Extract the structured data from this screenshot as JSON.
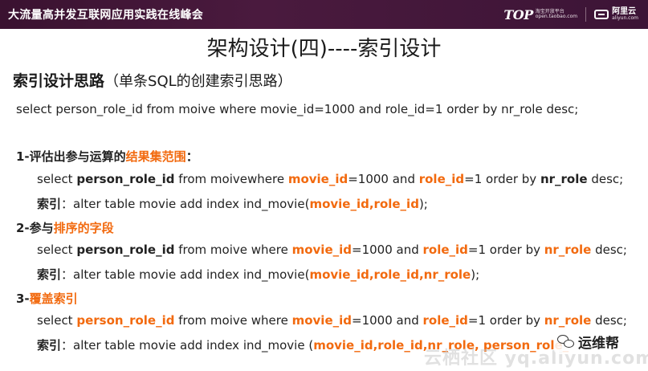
{
  "header": {
    "title": "大流量高并发互联网应用实践在线峰会",
    "brand_top": "TOP",
    "brand_sub_1": "淘宝开放平台",
    "brand_sub_2": "open.taobao.com",
    "brand_aliyun_cn": "阿里云",
    "brand_aliyun_en": "aliyun.com"
  },
  "slide": {
    "title": "架构设计(四)----索引设计",
    "subtitle_bold": "索引设计思路",
    "subtitle_normal": "（单条SQL的创建索引思路）",
    "query": "select  person_role_id from moive  where movie_id=1000 and role_id=1 order by nr_role desc;",
    "section1": {
      "num": "1-评估出参与运算的",
      "highlight": "结果集范围",
      "colon": "：",
      "q_1": "select  ",
      "q_2": "person_role_id",
      "q_3": " from moivewhere ",
      "q_4": "movie_id",
      "q_5": "=1000 and ",
      "q_6": "role_id",
      "q_7": "=1 order by ",
      "q_8": "nr_role",
      "q_9": " desc;",
      "idx_label": "索引",
      "idx_text": "：alter table movie add index ind_movie(",
      "idx_cols": "movie_id,role_id",
      "idx_end": ");"
    },
    "section2": {
      "num": "2-参与",
      "highlight": "排序的字段",
      "q_1": "select  ",
      "q_2": "person_role_id",
      "q_3": " from moive where ",
      "q_4": "movie_id",
      "q_5": "=1000  and ",
      "q_6": "role_id",
      "q_7": "=1 order by ",
      "q_8": "nr_role",
      "q_9": " desc;",
      "idx_label": "索引",
      "idx_text": "：alter table movie add index ind_movie(",
      "idx_cols": "movie_id,role_id,nr_role",
      "idx_end": ");"
    },
    "section3": {
      "num": "3-",
      "highlight": "覆盖索引",
      "q_1": "select  ",
      "q_2": "person_role_id",
      "q_3": " from moive where ",
      "q_4": "movie_id",
      "q_5": "=1000  and ",
      "q_6": "role_id",
      "q_7": "=1 order by ",
      "q_8": "nr_role",
      "q_9": " desc;",
      "idx_label": "索引",
      "idx_text": "：alter table movie add index ind_movie (",
      "idx_cols": "movie_id,role_id,nr_role, person_role_"
    }
  },
  "overlay": {
    "watermark": "云栖社区 yq.aliyun.com",
    "wechat_label": "运维帮"
  }
}
